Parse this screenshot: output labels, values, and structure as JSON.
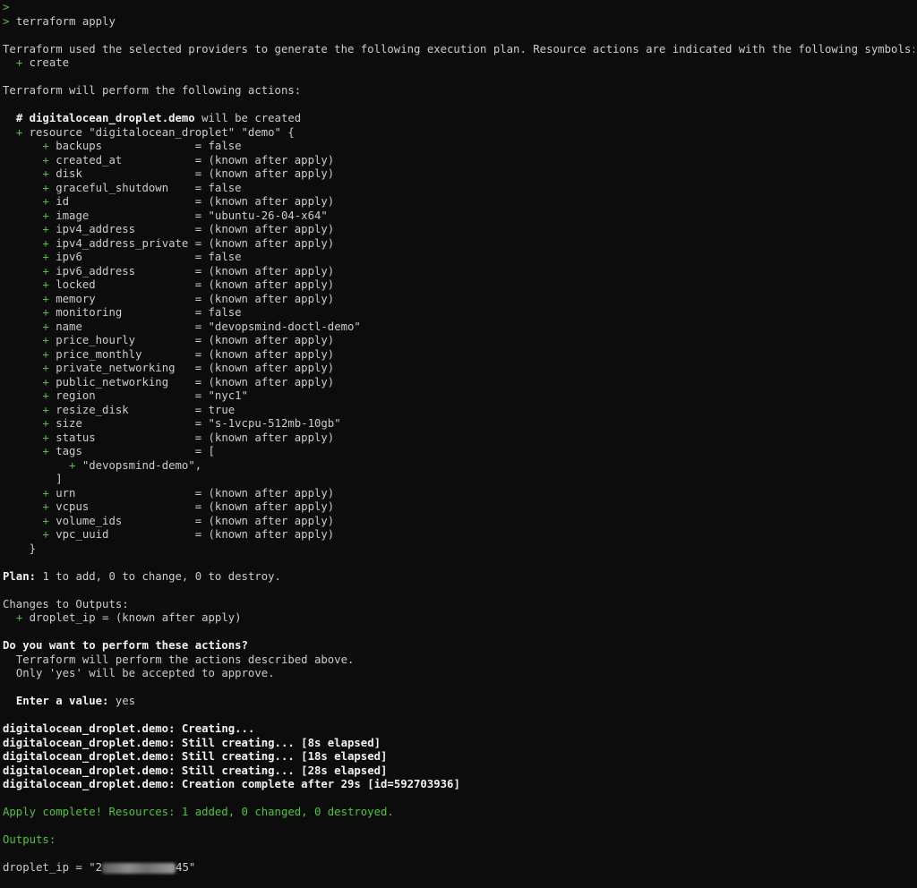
{
  "command": {
    "prompt": ">",
    "text": "terraform apply"
  },
  "intro": {
    "line": "Terraform used the selected providers to generate the following execution plan. Resource actions are indicated with the following symbols:",
    "create_symbol": "+",
    "create_label": "create"
  },
  "perform_heading": "Terraform will perform the following actions:",
  "resource": {
    "comment_hash": "#",
    "comment_name": "digitalocean_droplet.demo",
    "comment_suffix": "will be created",
    "header": "resource \"digitalocean_droplet\" \"demo\" {",
    "attributes": [
      {
        "key": "backups",
        "value": "false"
      },
      {
        "key": "created_at",
        "value": "(known after apply)"
      },
      {
        "key": "disk",
        "value": "(known after apply)"
      },
      {
        "key": "graceful_shutdown",
        "value": "false"
      },
      {
        "key": "id",
        "value": "(known after apply)"
      },
      {
        "key": "image",
        "value": "\"ubuntu-26-04-x64\""
      },
      {
        "key": "ipv4_address",
        "value": "(known after apply)"
      },
      {
        "key": "ipv4_address_private",
        "value": "(known after apply)"
      },
      {
        "key": "ipv6",
        "value": "false"
      },
      {
        "key": "ipv6_address",
        "value": "(known after apply)"
      },
      {
        "key": "locked",
        "value": "(known after apply)"
      },
      {
        "key": "memory",
        "value": "(known after apply)"
      },
      {
        "key": "monitoring",
        "value": "false"
      },
      {
        "key": "name",
        "value": "\"devopsmind-doctl-demo\""
      },
      {
        "key": "price_hourly",
        "value": "(known after apply)"
      },
      {
        "key": "price_monthly",
        "value": "(known after apply)"
      },
      {
        "key": "private_networking",
        "value": "(known after apply)"
      },
      {
        "key": "public_networking",
        "value": "(known after apply)"
      },
      {
        "key": "region",
        "value": "\"nyc1\""
      },
      {
        "key": "resize_disk",
        "value": "true"
      },
      {
        "key": "size",
        "value": "\"s-1vcpu-512mb-10gb\""
      },
      {
        "key": "status",
        "value": "(known after apply)"
      }
    ],
    "tags": {
      "key": "tags",
      "open": "[",
      "item": "\"devopsmind-demo\",",
      "close": "]"
    },
    "attributes_after": [
      {
        "key": "urn",
        "value": "(known after apply)"
      },
      {
        "key": "vcpus",
        "value": "(known after apply)"
      },
      {
        "key": "volume_ids",
        "value": "(known after apply)"
      },
      {
        "key": "vpc_uuid",
        "value": "(known after apply)"
      }
    ],
    "close": "}"
  },
  "plan": {
    "label": "Plan:",
    "text": "1 to add, 0 to change, 0 to destroy."
  },
  "outputs_change": {
    "heading": "Changes to Outputs:",
    "line": "droplet_ip = (known after apply)"
  },
  "confirm": {
    "question": "Do you want to perform these actions?",
    "line1": "Terraform will perform the actions described above.",
    "line2": "Only 'yes' will be accepted to approve.",
    "enter_label": "Enter a value:",
    "enter_value": "yes"
  },
  "progress": [
    {
      "resource": "digitalocean_droplet.demo:",
      "message": "Creating..."
    },
    {
      "resource": "digitalocean_droplet.demo:",
      "message": "Still creating... [8s elapsed]"
    },
    {
      "resource": "digitalocean_droplet.demo:",
      "message": "Still creating... [18s elapsed]"
    },
    {
      "resource": "digitalocean_droplet.demo:",
      "message": "Still creating... [28s elapsed]"
    },
    {
      "resource": "digitalocean_droplet.demo:",
      "message": "Creation complete after 29s [id=592703936]"
    }
  ],
  "apply_complete": "Apply complete! Resources: 1 added, 0 changed, 0 destroyed.",
  "outputs_heading": "Outputs:",
  "final_output": {
    "prefix": "droplet_ip = \"2",
    "suffix": "45\""
  },
  "colors": {
    "background": "#0c0c0c",
    "text": "#cccccc",
    "green": "#4fc43c",
    "bold": "#f2f2f2"
  }
}
